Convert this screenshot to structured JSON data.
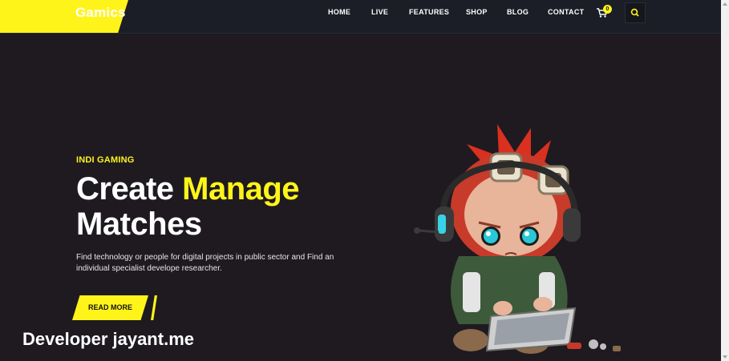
{
  "header": {
    "logo": "Gamics",
    "nav": [
      "HOME",
      "LIVE",
      "FEATURES",
      "SHOP",
      "BLOG",
      "CONTACT"
    ],
    "cart_count": "0"
  },
  "hero": {
    "subtitle": "INDI GAMING",
    "title_part1": "Create ",
    "title_accent": "Manage",
    "title_part2": "Matches",
    "description": "Find technology or people for digital projects in public sector and Find an individual specialist develope researcher.",
    "button": "READ MORE"
  },
  "watermark": "Developer jayant.me",
  "colors": {
    "accent": "#fff41a",
    "background": "#1e1a20",
    "header": "#1b1e27"
  },
  "icons": [
    "cart-icon",
    "search-icon"
  ]
}
